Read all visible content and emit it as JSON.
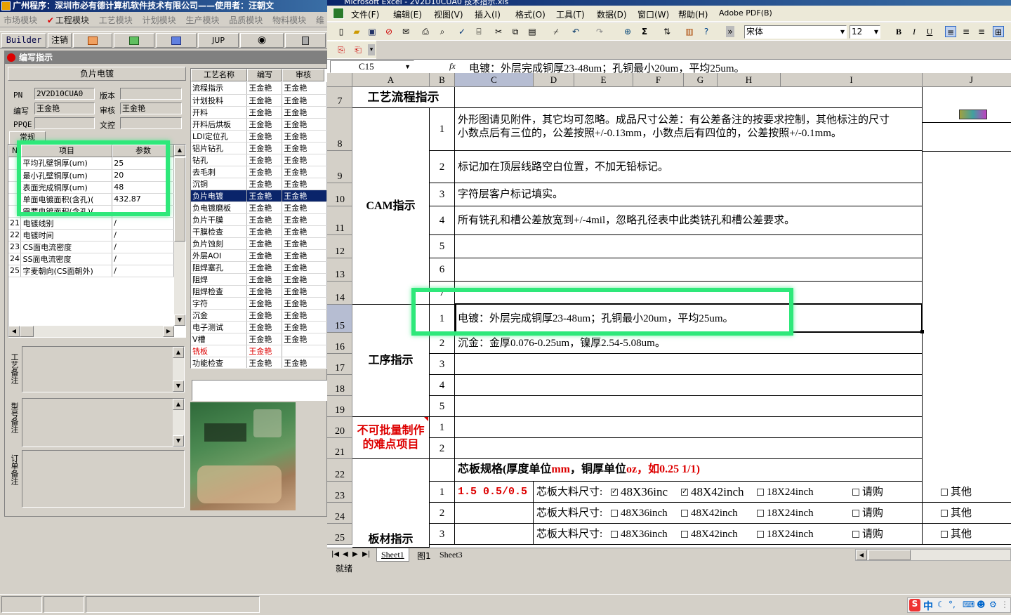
{
  "left": {
    "title": "广州程序：深圳市必有德计算机软件技术有限公司——使用者：汪朝文",
    "modules": [
      "市场模块",
      "工程模块",
      "工艺模块",
      "计划模块",
      "生产模块",
      "品质模块",
      "物料模块",
      "维"
    ],
    "toolbar": {
      "builder": "Builder",
      "logout": "注销",
      "jup": "JUP"
    },
    "panel_title": "编写指示",
    "section_title": "负片电镀",
    "form": {
      "pn_label": "PN",
      "pn_value": "2V2D10CUA0",
      "version_label": "版本",
      "version_value": "",
      "writer_label": "编写",
      "writer_value": "王金艳",
      "reviewer_label": "审核",
      "reviewer_value": "王金艳",
      "ppqe_label": "PPQE",
      "ppqe_value": "",
      "control_label": "文控",
      "control_value": ""
    },
    "tab_general": "常规",
    "params": {
      "headers": [
        "N",
        "项目",
        "参数"
      ],
      "rows": [
        {
          "no": "",
          "item": "平均孔壁铜厚(um)",
          "value": "25"
        },
        {
          "no": "",
          "item": "最小孔壁铜厚(um)",
          "value": "20"
        },
        {
          "no": "",
          "item": "表面完成铜厚(um)",
          "value": "48"
        },
        {
          "no": "",
          "item": "单面电镀面积(含孔)(",
          "value": "432.87"
        },
        {
          "no": "",
          "item": "需要电镀面积(含孔)(",
          "value": ""
        },
        {
          "no": "21",
          "item": "电镀线别",
          "value": "/"
        },
        {
          "no": "22",
          "item": "电镀时间",
          "value": "/"
        },
        {
          "no": "23",
          "item": "CS面电流密度",
          "value": "/"
        },
        {
          "no": "24",
          "item": "SS面电流密度",
          "value": "/"
        },
        {
          "no": "25",
          "item": "字麦朝向(CS面朝外)",
          "value": "/"
        }
      ]
    },
    "process": {
      "headers": [
        "工艺名称",
        "编写",
        "审核"
      ],
      "rows": [
        {
          "name": "流程指示",
          "writer": "王金艳",
          "reviewer": "王金艳"
        },
        {
          "name": "计划投料",
          "writer": "王金艳",
          "reviewer": "王金艳"
        },
        {
          "name": "开料",
          "writer": "王金艳",
          "reviewer": "王金艳"
        },
        {
          "name": "开料后烘板",
          "writer": "王金艳",
          "reviewer": "王金艳"
        },
        {
          "name": "LDI定位孔",
          "writer": "王金艳",
          "reviewer": "王金艳"
        },
        {
          "name": "铝片钻孔",
          "writer": "王金艳",
          "reviewer": "王金艳"
        },
        {
          "name": "钻孔",
          "writer": "王金艳",
          "reviewer": "王金艳"
        },
        {
          "name": "去毛刺",
          "writer": "王金艳",
          "reviewer": "王金艳"
        },
        {
          "name": "沉铜",
          "writer": "王金艳",
          "reviewer": "王金艳"
        },
        {
          "name": "负片电镀",
          "writer": "王金艳",
          "reviewer": "王金艳",
          "selected": true
        },
        {
          "name": "负电镀磨板",
          "writer": "王金艳",
          "reviewer": "王金艳"
        },
        {
          "name": "负片干膜",
          "writer": "王金艳",
          "reviewer": "王金艳"
        },
        {
          "name": "干膜检查",
          "writer": "王金艳",
          "reviewer": "王金艳"
        },
        {
          "name": "负片蚀刻",
          "writer": "王金艳",
          "reviewer": "王金艳"
        },
        {
          "name": "外层AOI",
          "writer": "王金艳",
          "reviewer": "王金艳"
        },
        {
          "name": "阻焊塞孔",
          "writer": "王金艳",
          "reviewer": "王金艳"
        },
        {
          "name": "阻焊",
          "writer": "王金艳",
          "reviewer": "王金艳"
        },
        {
          "name": "阻焊检查",
          "writer": "王金艳",
          "reviewer": "王金艳"
        },
        {
          "name": "字符",
          "writer": "王金艳",
          "reviewer": "王金艳"
        },
        {
          "name": "沉金",
          "writer": "王金艳",
          "reviewer": "王金艳"
        },
        {
          "name": "电子测试",
          "writer": "王金艳",
          "reviewer": "王金艳"
        },
        {
          "name": "V槽",
          "writer": "王金艳",
          "reviewer": "王金艳"
        },
        {
          "name": "铣板",
          "writer": "王金艳",
          "reviewer": "",
          "red": true
        },
        {
          "name": "功能检查",
          "writer": "王金艳",
          "reviewer": "王金艳"
        }
      ]
    },
    "notes": {
      "process_note": "工艺备注",
      "model_note": "型号备注",
      "order_note": "订单备注"
    }
  },
  "excel": {
    "title": "Microsoft Excel - 2V2D10CUA0 技术指示.xls",
    "menu": [
      "文件(F)",
      "编辑(E)",
      "视图(V)",
      "插入(I)",
      "格式(O)",
      "工具(T)",
      "数据(D)",
      "窗口(W)",
      "帮助(H)",
      "Adobe PDF(B)"
    ],
    "font_name": "宋体",
    "font_size": "12",
    "name_box": "C15",
    "fx": "fx",
    "formula": "电镀：外层完成铜厚23-48um；孔铜最小20um，平均25um。",
    "columns": [
      "A",
      "B",
      "C",
      "D",
      "E",
      "F",
      "G",
      "H",
      "I",
      "J"
    ],
    "rows": [
      "7",
      "8",
      "9",
      "10",
      "11",
      "12",
      "13",
      "14",
      "15",
      "16",
      "17",
      "18",
      "19",
      "20",
      "21",
      "22",
      "23",
      "24",
      "25"
    ],
    "sections": {
      "flow": "工艺流程指示",
      "cam": "CAM指示",
      "procedure": "工序指示",
      "difficult": "不可批量制作的难点项目",
      "material": "板材指示"
    },
    "cam_items": [
      {
        "no": "1",
        "text": "外形图请见附件，其它均可忽略。成品尺寸公差：有公差备注的按要求控制，其他标注的尺寸",
        "text2": "小数点后有三位的，公差按照+/-0.13mm，小数点后有四位的，公差按照+/-0.1mm。"
      },
      {
        "no": "2",
        "text": "标记加在顶层线路空白位置，不加无铅标记。"
      },
      {
        "no": "3",
        "text": "字符层客户标记填实。"
      },
      {
        "no": "4",
        "text": "所有铣孔和槽公差放宽到+/-4mil，忽略孔径表中此类铣孔和槽公差要求。"
      },
      {
        "no": "5",
        "text": ""
      },
      {
        "no": "6",
        "text": ""
      },
      {
        "no": "7",
        "text": ""
      }
    ],
    "proc_items": [
      {
        "no": "1",
        "text": "电镀：外层完成铜厚23-48um；孔铜最小20um，平均25um。"
      },
      {
        "no": "2",
        "text": "沉金：金厚0.076-0.25um，镍厚2.54-5.08um。"
      },
      {
        "no": "3",
        "text": ""
      },
      {
        "no": "4",
        "text": ""
      },
      {
        "no": "5",
        "text": ""
      }
    ],
    "diff_items": [
      {
        "no": "1"
      },
      {
        "no": "2"
      }
    ],
    "core": {
      "header_a": "芯板规格(厚度单位",
      "header_mm": "mm",
      "header_b": "，铜厚单位",
      "header_oz": "oz",
      "header_c": "，如0.25 1/1)",
      "rows": [
        {
          "no": "1",
          "spec": "1.5 0.5/0.5",
          "label": "芯板大料尺寸:",
          "opt1": "48X36inc",
          "opt1_checked": true,
          "opt2": "48X42inch",
          "opt2_checked": true,
          "opt3": "18X24inch",
          "opt4": "请购",
          "opt5": "其他"
        },
        {
          "no": "2",
          "spec": "",
          "label": "芯板大料尺寸:",
          "opt1": "48X36inch",
          "opt1_checked": false,
          "opt2": "48X42inch",
          "opt2_checked": false,
          "opt3": "18X24inch",
          "opt4": "请购",
          "opt5": "其他"
        },
        {
          "no": "3",
          "spec": "",
          "label": "芯板大料尺寸:",
          "opt1": "48X36inch",
          "opt1_checked": false,
          "opt2": "48X42inch",
          "opt2_checked": false,
          "opt3": "18X24inch",
          "opt4": "请购",
          "opt5": "其他"
        }
      ]
    },
    "sheet_tabs": [
      "Sheet1",
      "图1",
      "Sheet3"
    ],
    "status": "就绪"
  },
  "taskbar": {
    "ime": "中"
  }
}
